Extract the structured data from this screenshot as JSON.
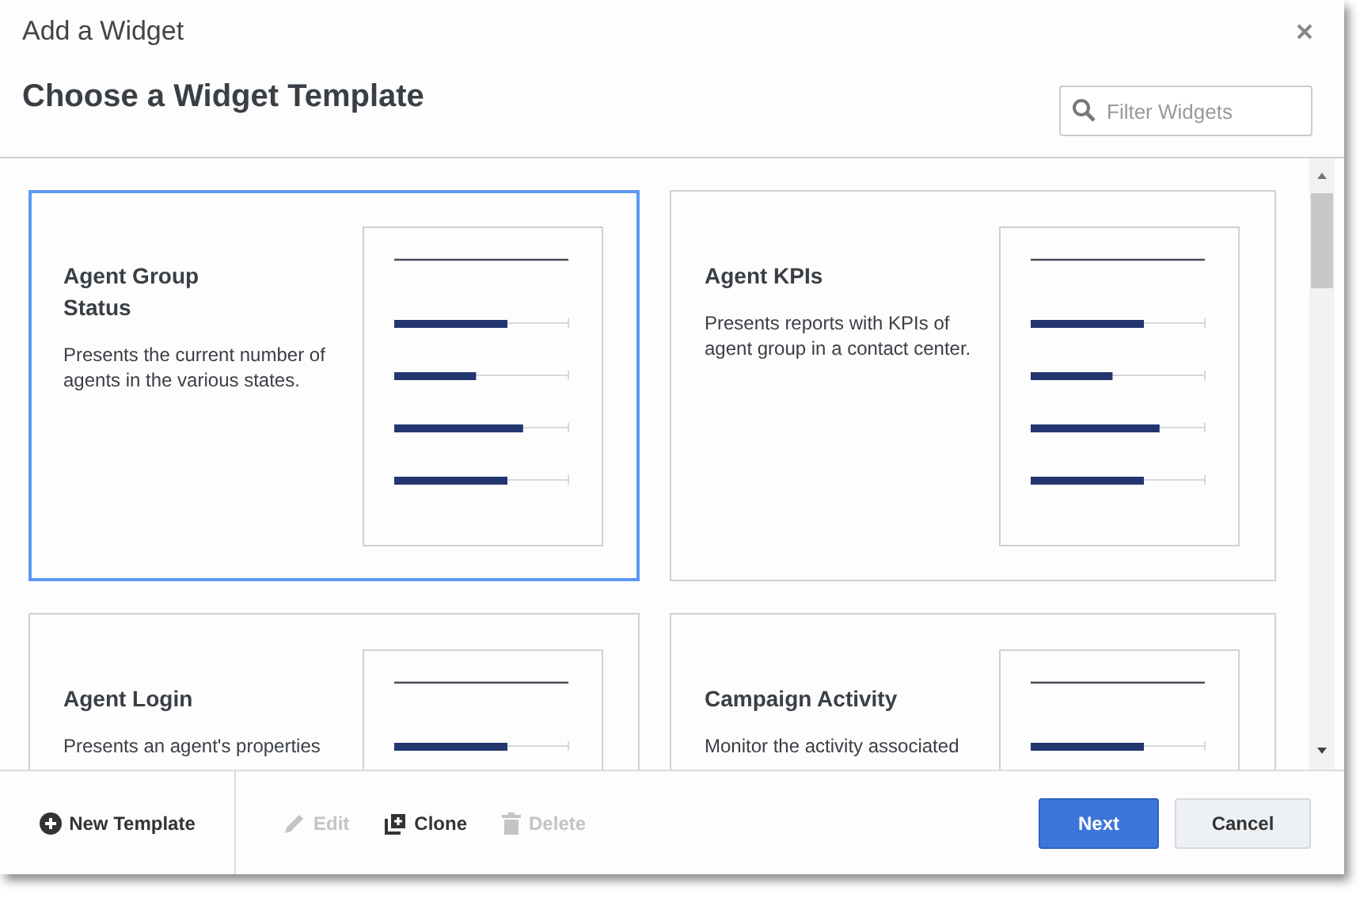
{
  "window": {
    "title": "Add a Widget"
  },
  "heading": "Choose a Widget Template",
  "search": {
    "placeholder": "Filter Widgets"
  },
  "templates": [
    {
      "title": "Agent Group Status",
      "description": "Presents the current number of agents in the various states.",
      "selected": true
    },
    {
      "title": "Agent KPIs",
      "description": "Presents reports with KPIs of agent group in a contact center.",
      "selected": false
    },
    {
      "title": "Agent Login",
      "description": "Presents an agent's properties",
      "selected": false
    },
    {
      "title": "Campaign Activity",
      "description": "Monitor the activity associated",
      "selected": false
    }
  ],
  "footer": {
    "new_template": "New Template",
    "actions": [
      {
        "kind": "edit",
        "label": "Edit",
        "disabled": true
      },
      {
        "kind": "clone",
        "label": "Clone",
        "disabled": false
      },
      {
        "kind": "delete",
        "label": "Delete",
        "disabled": true
      }
    ],
    "next": "Next",
    "cancel": "Cancel"
  }
}
